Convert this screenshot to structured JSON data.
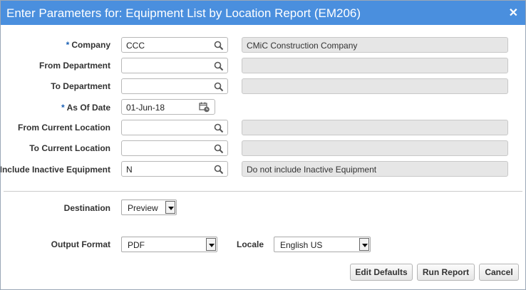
{
  "dialog": {
    "title": "Enter Parameters for: Equipment List by Location Report (EM206)",
    "close_glyph": "✕"
  },
  "fields": {
    "company": {
      "required_mark": "*",
      "label": "Company",
      "value": "CCC",
      "description": "CMiC Construction Company"
    },
    "from_department": {
      "label": "From Department",
      "value": "",
      "description": ""
    },
    "to_department": {
      "label": "To Department",
      "value": "",
      "description": ""
    },
    "as_of_date": {
      "required_mark": "*",
      "label": "As Of Date",
      "value": "01-Jun-18"
    },
    "from_current_location": {
      "label": "From Current Location",
      "value": "",
      "description": ""
    },
    "to_current_location": {
      "label": "To Current Location",
      "value": "",
      "description": ""
    },
    "include_inactive_equipment": {
      "label": "Include Inactive Equipment",
      "value": "N",
      "description": "Do not include Inactive Equipment"
    }
  },
  "output": {
    "destination_label": "Destination",
    "destination_value": "Preview",
    "output_format_label": "Output Format",
    "output_format_value": "PDF",
    "locale_label": "Locale",
    "locale_value": "English US"
  },
  "buttons": {
    "edit_defaults": "Edit Defaults",
    "run_report": "Run Report",
    "cancel": "Cancel"
  },
  "colors": {
    "title_bar": "#4a8fde",
    "required_mark": "#1a5fb4"
  },
  "icons": {
    "lookup": "search-icon",
    "date": "calendar-icon"
  }
}
